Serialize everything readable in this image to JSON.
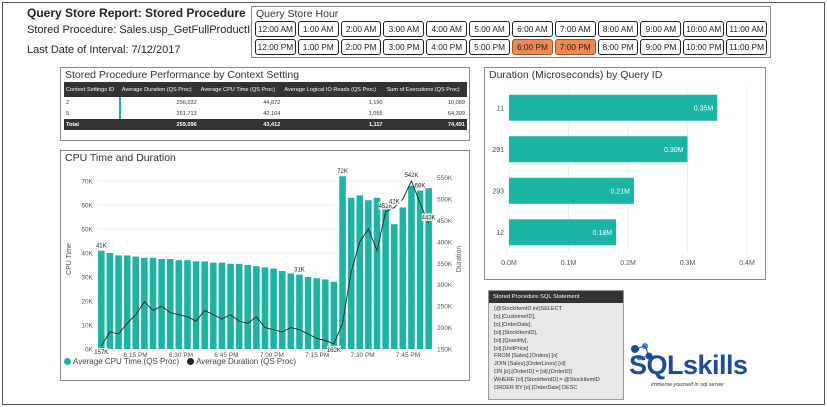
{
  "header": {
    "title": "Query Store Report: Stored Procedure",
    "procedure": "Stored Procedure: Sales.usp_GetFullProductInfo",
    "last_date": "Last Date of Interval: 7/12/2017"
  },
  "slicer": {
    "title": "Query Store Hour",
    "hours": [
      "12:00 AM",
      "1:00 AM",
      "2:00 AM",
      "3:00 AM",
      "4:00 AM",
      "5:00 AM",
      "6:00 AM",
      "7:00 AM",
      "8:00 AM",
      "9:00 AM",
      "10:00 AM",
      "11:00 AM",
      "12:00 PM",
      "1:00 PM",
      "2:00 PM",
      "3:00 PM",
      "4:00 PM",
      "5:00 PM",
      "6:00 PM",
      "7:00 PM",
      "8:00 PM",
      "9:00 PM",
      "10:00 PM",
      "11:00 PM"
    ],
    "selected": [
      "6:00 PM",
      "7:00 PM"
    ],
    "selected_color": "#f08a52"
  },
  "perf_table": {
    "title": "Stored Procedure Performance by Context Setting",
    "columns": [
      "Context Settings ID",
      "Average Duration (QS Proc)",
      "Average CPU Time (QS Proc)",
      "Average Logical IO Reads (QS Proc)",
      "Sum of Executions (QS Proc)"
    ],
    "rows": [
      [
        "2",
        "256,032",
        "44,872",
        "1,190",
        "10,089"
      ],
      [
        "5",
        "261,713",
        "42,164",
        "1,055",
        "64,399"
      ]
    ],
    "total": [
      "Total",
      "259,096",
      "43,412",
      "1,117",
      "74,491"
    ]
  },
  "duration_chart": {
    "title": "Duration (Microseconds) by Query ID",
    "color": "#1bb5a6",
    "queries": [
      {
        "id": "11",
        "value": 0.35,
        "label": "0.35M"
      },
      {
        "id": "291",
        "value": 0.3,
        "label": "0.30M"
      },
      {
        "id": "293",
        "value": 0.21,
        "label": "0.21M"
      },
      {
        "id": "12",
        "value": 0.18,
        "label": "0.18M"
      }
    ],
    "x_ticks": [
      "0.0M",
      "0.1M",
      "0.2M",
      "0.3M",
      "0.4M"
    ],
    "x_max": 0.4
  },
  "chart_data": {
    "type": "bar",
    "title": "CPU Time and Duration",
    "y_left_label": "CPU Time",
    "y_right_label": "Duration",
    "y_left_ticks": [
      "0K",
      "10K",
      "20K",
      "30K",
      "40K",
      "50K",
      "60K",
      "70K"
    ],
    "y_left_max": 75000,
    "y_right_ticks": [
      "150K",
      "200K",
      "250K",
      "300K",
      "350K",
      "400K",
      "450K",
      "500K",
      "550K"
    ],
    "y_right_min": 150000,
    "y_right_max": 570000,
    "x_tick_labels": [
      "6:15 PM",
      "6:30 PM",
      "6:45 PM",
      "7:00 PM",
      "7:15 PM",
      "7:30 PM",
      "7:45 PM"
    ],
    "series": [
      {
        "name": "Average CPU Time (QS Proc)",
        "color": "#1bb5a6",
        "values": [
          41000,
          40000,
          39000,
          39000,
          38500,
          38000,
          38000,
          37500,
          37500,
          37000,
          37000,
          36500,
          36500,
          36000,
          36000,
          35500,
          35500,
          35000,
          34500,
          34000,
          33500,
          32500,
          31500,
          31000,
          30000,
          29500,
          29000,
          28000,
          72000,
          63000,
          64000,
          62000,
          63000,
          61000,
          52000,
          59000,
          68000,
          66000,
          67000
        ],
        "labels": {
          "0": "41K",
          "23": "31K",
          "28": "72K",
          "37": "68K"
        }
      },
      {
        "name": "Average Duration (QS Proc)",
        "color": "#222222",
        "values": [
          157000,
          190000,
          185000,
          210000,
          230000,
          260000,
          240000,
          250000,
          235000,
          230000,
          225000,
          215000,
          240000,
          230000,
          220000,
          230000,
          215000,
          210000,
          225000,
          200000,
          195000,
          190000,
          200000,
          195000,
          185000,
          175000,
          170000,
          162000,
          210000,
          330000,
          400000,
          430000,
          380000,
          470000,
          480000,
          500000,
          542000,
          490000,
          443000
        ],
        "labels": {
          "0": "157K",
          "27": "162K",
          "33": "452K",
          "36": "542K",
          "38": "443K",
          "34": "42K"
        }
      }
    ]
  },
  "sql": {
    "title": "Stored Procedure SQL Statement",
    "lines": [
      "(@StockItemID int)SELECT",
      "[o].[CustomerID],",
      "[o].[OrderDate],",
      "[ol].[StockItemID],",
      "[ol].[Quantity],",
      "[ol].[UnitPrice]",
      "FROM [Sales].[Orders] [o]",
      "JOIN [Sales].[OrderLines] [ol]",
      "ON [o].[OrderID] = [ol].[OrderID]",
      "WHERE [ol].[StockItemID] = @StockItemID",
      "ORDER BY [o].[OrderDate] DESC"
    ]
  },
  "logo": {
    "name": "SQLskills",
    "tagline": "immerse yourself in sql server",
    "color": "#1f4c9a"
  }
}
